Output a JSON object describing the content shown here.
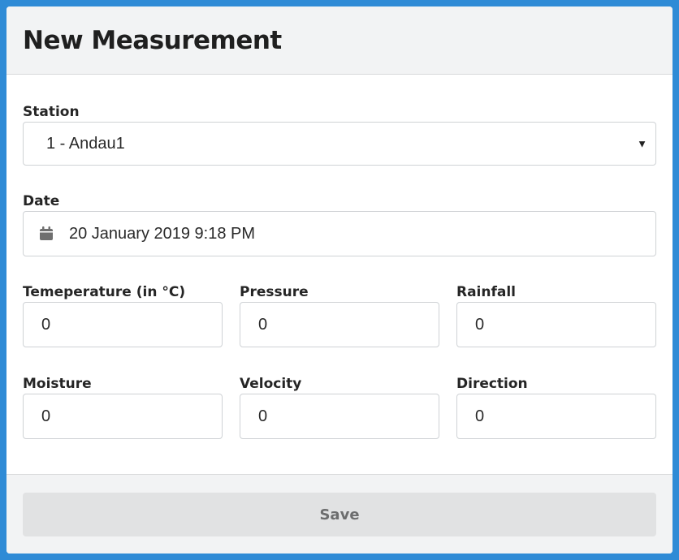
{
  "form": {
    "title": "New Measurement",
    "station": {
      "label": "Station",
      "selected": "1 - Andau1"
    },
    "date": {
      "label": "Date",
      "value": "20 January 2019 9:18 PM",
      "icon": "calendar-icon"
    },
    "fields": {
      "temperature": {
        "label": "Temeperature (in °C)",
        "value": "0"
      },
      "pressure": {
        "label": "Pressure",
        "value": "0"
      },
      "rainfall": {
        "label": "Rainfall",
        "value": "0"
      },
      "moisture": {
        "label": "Moisture",
        "value": "0"
      },
      "velocity": {
        "label": "Velocity",
        "value": "0"
      },
      "direction": {
        "label": "Direction",
        "value": "0"
      }
    },
    "save_label": "Save"
  },
  "colors": {
    "frame_border": "#2f8bd6",
    "header_bg": "#f2f3f4",
    "button_bg": "#e1e2e3",
    "button_text": "#6c6d6e",
    "input_border": "#cfd2d5"
  }
}
